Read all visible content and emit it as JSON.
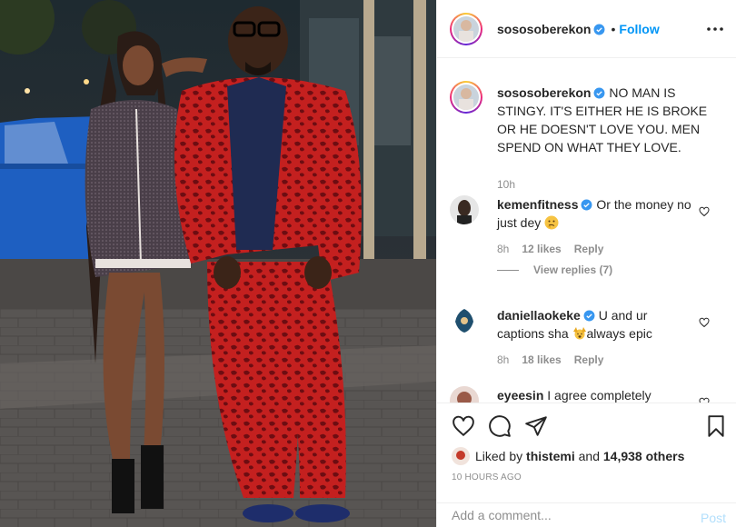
{
  "post": {
    "username": "sososoberekon",
    "verified": true,
    "follow_label": "Follow",
    "separator": "•",
    "caption": "NO MAN IS STINGY. IT'S EITHER HE IS BROKE OR HE DOESN'T LOVE YOU. MEN SPEND ON WHAT THEY LOVE.",
    "caption_time": "10h"
  },
  "comments": [
    {
      "username": "kemenfitness",
      "verified": true,
      "text": "Or the money no just dey",
      "emoji": "thinking-face",
      "time": "8h",
      "likes": "12 likes",
      "reply_label": "Reply",
      "view_replies": "View replies (7)"
    },
    {
      "username": "daniellaokeke",
      "verified": true,
      "text_before": "U and ur captions sha",
      "emoji": "raising-hands",
      "text_after": "always epic",
      "time": "8h",
      "likes": "18 likes",
      "reply_label": "Reply"
    },
    {
      "username": "eyeesin",
      "text": "I agree completely"
    }
  ],
  "likes": {
    "prefix": "Liked by",
    "liker": "thistemi",
    "middle": "and",
    "others": "14,938 others"
  },
  "post_time": "10 HOURS AGO",
  "add_comment": {
    "placeholder": "Add a comment...",
    "post_label": "Post"
  },
  "icons": {
    "like": "heart-icon",
    "comment": "comment-icon",
    "share": "paper-plane-icon",
    "save": "bookmark-icon",
    "more": "more-options-icon",
    "verified": "verified-badge-icon"
  },
  "colors": {
    "accent": "#0095f6",
    "verified": "#3897f0",
    "muted": "#8e8e8e",
    "post_disabled": "#b2dffc"
  }
}
